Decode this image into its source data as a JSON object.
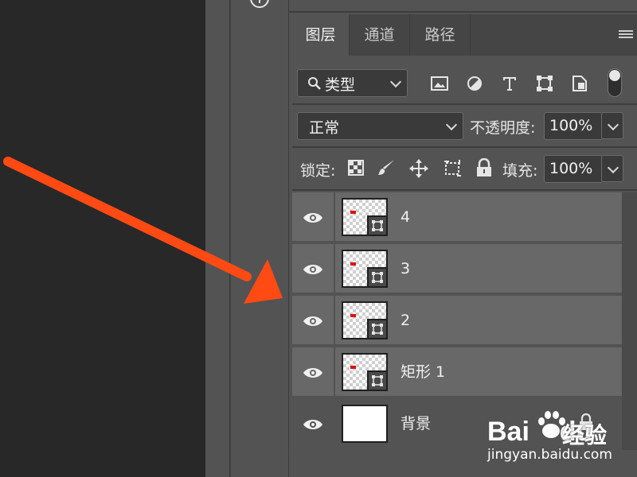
{
  "panel": {
    "tabs": [
      {
        "label": "图层",
        "active": true
      },
      {
        "label": "通道",
        "active": false
      },
      {
        "label": "路径",
        "active": false
      }
    ],
    "filter": {
      "label": "类型",
      "icons": [
        "image-filter-icon",
        "adjustment-filter-icon",
        "type-filter-icon",
        "shape-filter-icon",
        "smart-object-filter-icon",
        "filter-toggle-icon"
      ]
    },
    "blend_mode": "正常",
    "opacity_label": "不透明度:",
    "opacity_value": "100%",
    "lock_label": "锁定:",
    "lock_icons": [
      "lock-transparent-pixels-icon",
      "lock-image-pixels-icon",
      "lock-position-icon",
      "lock-artboard-icon",
      "lock-all-icon"
    ],
    "fill_label": "填充:",
    "fill_value": "100%"
  },
  "layers": [
    {
      "name": "4",
      "type": "shape"
    },
    {
      "name": "3",
      "type": "shape"
    },
    {
      "name": "2",
      "type": "shape"
    },
    {
      "name": "矩形 1",
      "type": "shape"
    },
    {
      "name": "背景",
      "type": "background",
      "locked": true
    }
  ],
  "annotation": {
    "arrow_color": "#ff4a14"
  },
  "watermark": {
    "logo": "Bai",
    "logo_tail": "du",
    "cn": "经验",
    "url": "jingyan.baidu.com"
  }
}
